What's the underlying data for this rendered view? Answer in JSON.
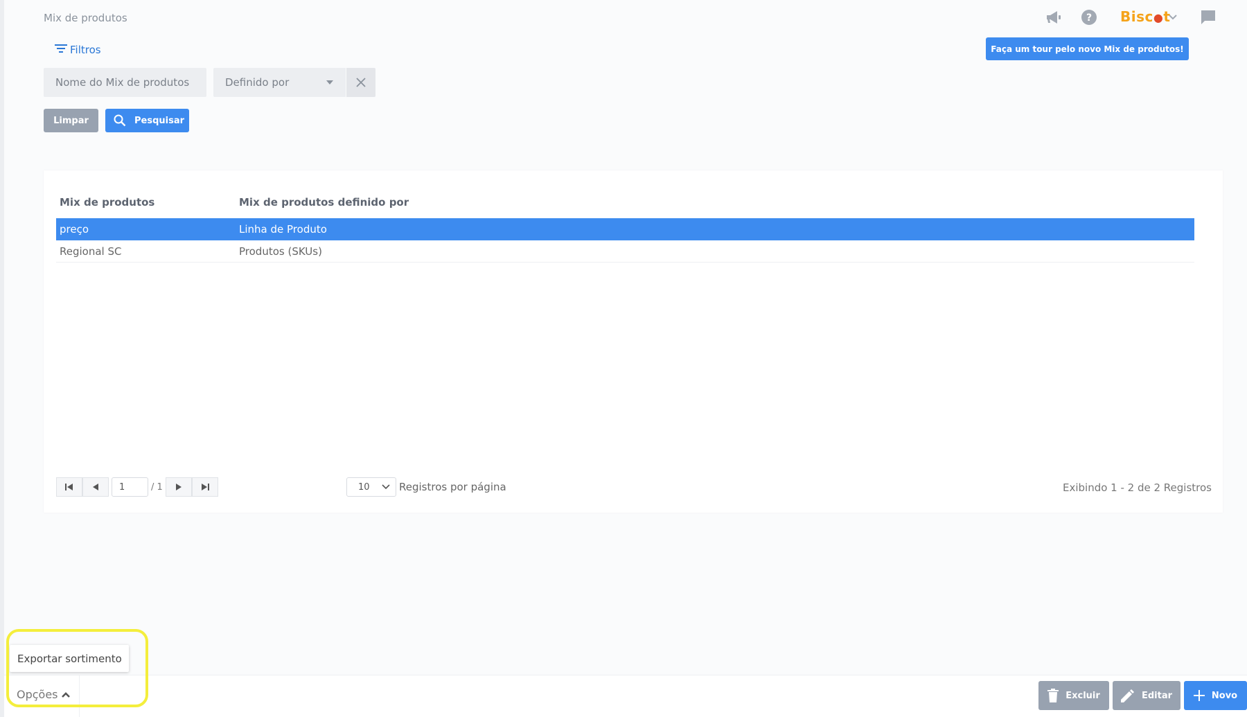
{
  "header": {
    "page_title": "Mix de produtos",
    "brand_prefix": "Bisc",
    "brand_dot": "●",
    "brand_suffix": "t",
    "tour_button": "Faça um tour pelo novo Mix de produtos!"
  },
  "filters": {
    "toggle_label": "Filtros",
    "name_placeholder": "Nome do Mix de produtos",
    "defined_by_placeholder": "Definido por",
    "clear_button": "Limpar",
    "search_button": "Pesquisar"
  },
  "table": {
    "columns": [
      "Mix de produtos",
      "Mix de produtos definido por"
    ],
    "rows": [
      {
        "name": "preço",
        "defined_by": "Linha de Produto"
      },
      {
        "name": "Regional SC",
        "defined_by": "Produtos (SKUs)"
      }
    ]
  },
  "pagination": {
    "current_page": "1",
    "total_pages": "/ 1",
    "per_page": "10",
    "per_page_label": "Registros por página",
    "showing": "Exibindo 1 - 2 de 2 Registros"
  },
  "footer": {
    "options_label": "Opções",
    "options_menu_item": "Exportar sortimento",
    "delete_button": "Excluir",
    "edit_button": "Editar",
    "new_button": "Novo"
  },
  "colors": {
    "primary": "#3d8bef",
    "secondary": "#98a2b0",
    "brand": "#f5a31a",
    "highlight": "#f4ee3c"
  }
}
